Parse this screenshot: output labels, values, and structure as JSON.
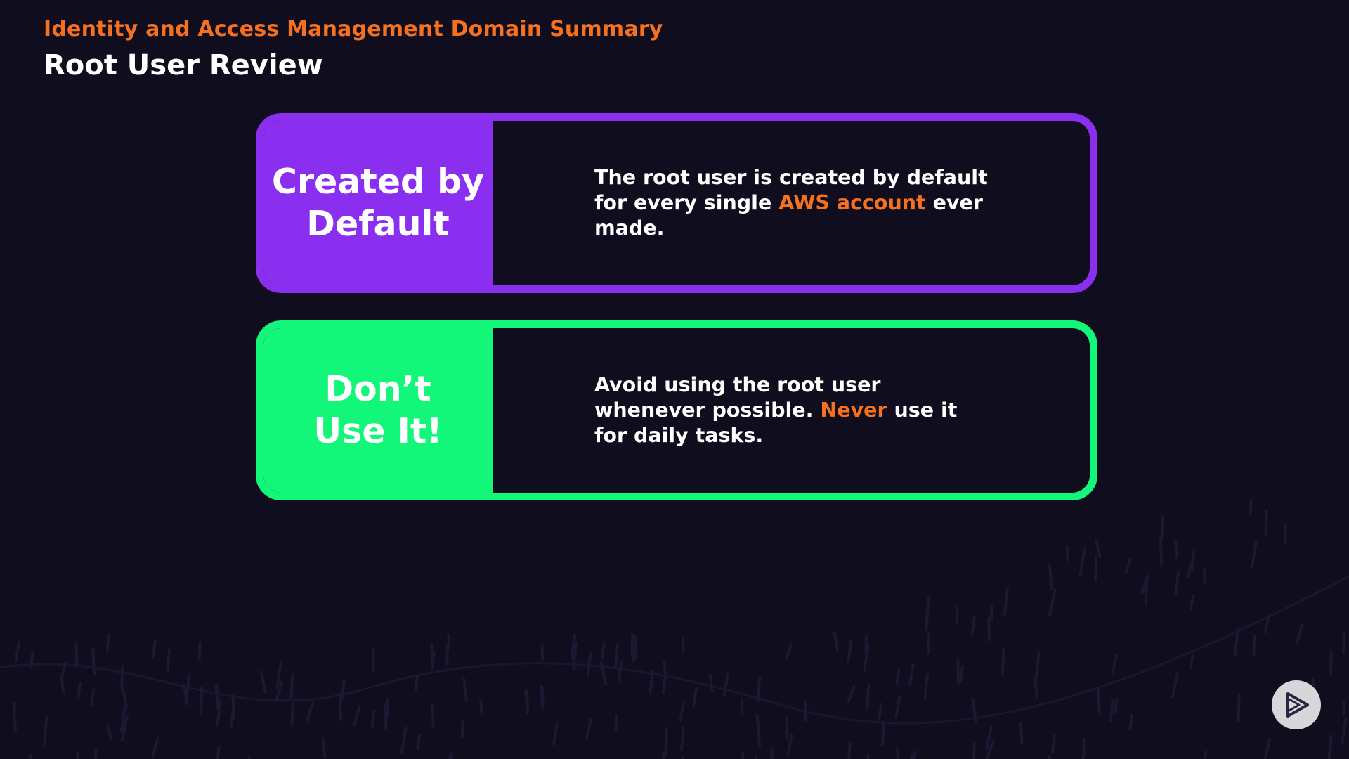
{
  "header": {
    "subtitle": "Identity and Access Management Domain Summary",
    "title": "Root User Review"
  },
  "cards": [
    {
      "label": "Created by\nDefault",
      "desc_before": "The root user is created by default for every single ",
      "desc_highlight": "AWS account",
      "desc_after": " ever made.",
      "color": "#8a2ff0"
    },
    {
      "label": "Don’t\nUse It!",
      "desc_before": "Avoid using the root user whenever possible. ",
      "desc_highlight": "Never",
      "desc_after": " use it for daily tasks.",
      "color": "#12f77a"
    }
  ],
  "colors": {
    "background": "#100d1f",
    "accent": "#f5701f",
    "text": "#ffffff"
  },
  "icons": {
    "play_button": "play-triangle-icon"
  }
}
